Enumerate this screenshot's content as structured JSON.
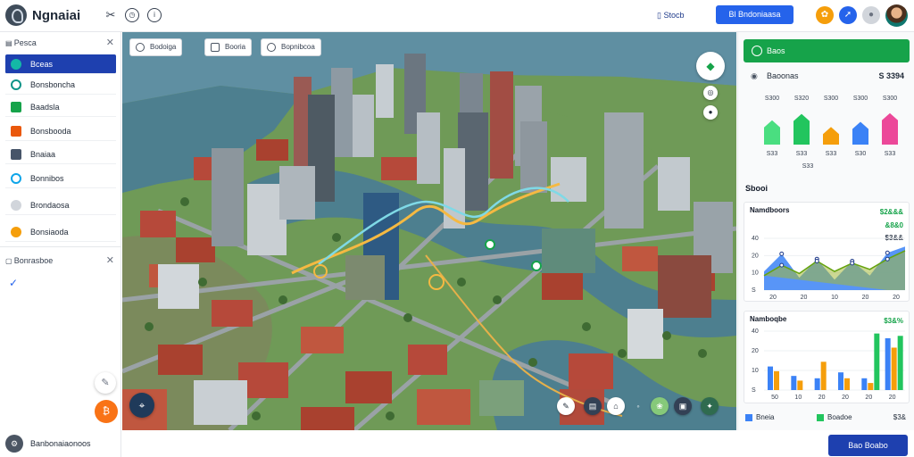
{
  "header": {
    "app_title": "Ngnaiai",
    "search_label": "Stocb",
    "primary_button": "Bl Bndoniaasa",
    "icons": [
      "tools-icon",
      "clock-icon",
      "info-icon",
      "orange-gear-icon",
      "blue-rocket-icon",
      "user-grey-icon",
      "avatar"
    ]
  },
  "left_panel": {
    "title": "Pesca",
    "items": [
      {
        "label": "Bceas",
        "color": "#14b8a6"
      },
      {
        "label": "Bonsboncha",
        "color": "#0d9488"
      },
      {
        "label": "Baadsla",
        "color": "#16a34a"
      },
      {
        "label": "Bonsbooda",
        "color": "#ea580c"
      },
      {
        "label": "Bnaiaa",
        "color": "#475569"
      },
      {
        "label": "Bonnibos",
        "color": "#0ea5e9"
      },
      {
        "label": "Brondaosa",
        "color": "#9ca3af"
      },
      {
        "label": "Bonsiaoda",
        "color": "#f59e0b"
      }
    ],
    "section2_title": "Bonrasboe",
    "footer_label": "Banbonaiaonoos"
  },
  "map": {
    "chips": [
      "Bodoiga",
      "Booria",
      "Bopnibcoa"
    ],
    "colors": {
      "water": "#4d7f8f",
      "grass": "#6f9a57",
      "road": "#8f979b",
      "route_yellow": "#f5b942",
      "route_cyan": "#7fd9e6"
    }
  },
  "right_panel": {
    "status_label": "Baos",
    "row1_label": "Baoonas",
    "row1_value": "S 3394",
    "bars_card": {
      "headers": [
        "S300",
        "S320",
        "S300",
        "S300",
        "S300"
      ],
      "labels": [
        "S33",
        "S33",
        "S33",
        "S30",
        "S33"
      ],
      "sub_label": "S33",
      "values": [
        0.62,
        0.78,
        0.45,
        0.58,
        0.8
      ],
      "colors": [
        "#4ade80",
        "#22c55e",
        "#f59e0b",
        "#3b82f6",
        "#ec4899"
      ]
    },
    "section_title": "Sbooi",
    "area_card": {
      "title": "Namdboors",
      "value1": "$2&&&",
      "value2": "&8&0",
      "value3": "$3&&",
      "y_labels": [
        "40",
        "20",
        "10",
        "S"
      ],
      "x_labels": [
        "20",
        "20",
        "10",
        "20",
        "20"
      ]
    },
    "bar_card": {
      "title": "Namboqbe",
      "value": "$3&%",
      "y_labels": [
        "40",
        "20",
        "10",
        "S"
      ],
      "x_labels": [
        "50",
        "10",
        "20",
        "20",
        "20",
        "20"
      ]
    },
    "legend": {
      "item1": "Bneia",
      "item2": "Boadoe",
      "value": "$3&"
    }
  },
  "footer": {
    "action_button": "Bao Boabo"
  },
  "chart_data": [
    {
      "type": "bar",
      "title": "",
      "categories": [
        "S33",
        "S33",
        "S33",
        "S30",
        "S33"
      ],
      "values": [
        62,
        78,
        45,
        58,
        80
      ],
      "ylim": [
        0,
        100
      ]
    },
    {
      "type": "area",
      "title": "Namdboors",
      "x": [
        "20",
        "20",
        "10",
        "20",
        "20"
      ],
      "series": [
        {
          "values": [
            18,
            35,
            12,
            30,
            10,
            28,
            14,
            36,
            42
          ],
          "color": "#3b82f6"
        },
        {
          "values": [
            14,
            24,
            16,
            28,
            18,
            26,
            20,
            30,
            38
          ],
          "color": "#a3b83a"
        }
      ],
      "ylim": [
        0,
        50
      ]
    },
    {
      "type": "bar",
      "title": "Namboqbe",
      "categories": [
        "50",
        "10",
        "20",
        "20",
        "20",
        "20"
      ],
      "series": [
        {
          "values": [
            20,
            12,
            10,
            15,
            10,
            44
          ],
          "color": "#3b82f6"
        },
        {
          "values": [
            16,
            8,
            24,
            10,
            6,
            36
          ],
          "color": "#f59e0b"
        },
        {
          "values": [
            0,
            0,
            0,
            0,
            48,
            46
          ],
          "color": "#22c55e"
        }
      ],
      "ylim": [
        0,
        50
      ]
    }
  ]
}
